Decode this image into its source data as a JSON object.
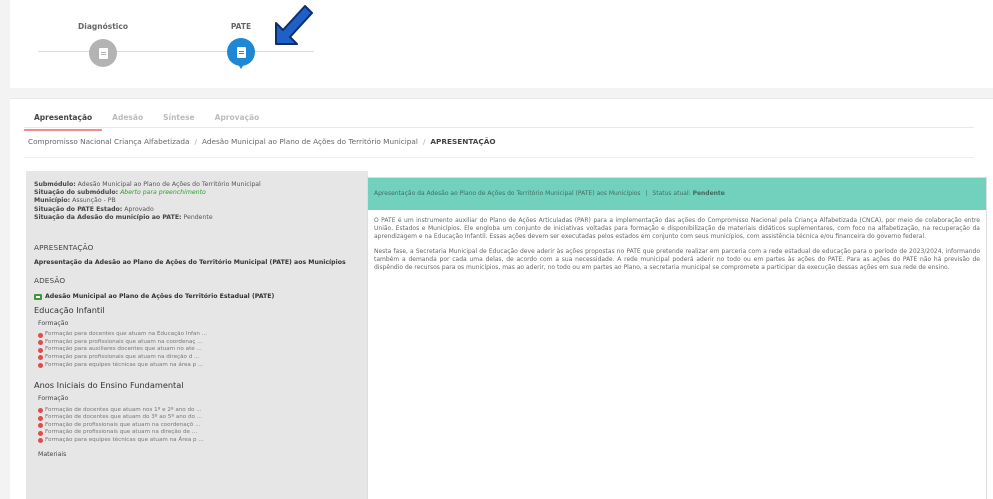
{
  "stepper": {
    "step1_label": "Diagnóstico",
    "step2_label": "PATE",
    "step1_icon": "document-icon",
    "step2_icon": "document-icon",
    "active_color": "#1e88d6",
    "inactive_color": "#b3b3b3"
  },
  "tabs": [
    {
      "label": "Apresentação"
    },
    {
      "label": "Adesão"
    },
    {
      "label": "Síntese"
    },
    {
      "label": "Aprovação"
    }
  ],
  "breadcrumb": {
    "item1": "Compromisso Nacional Criança Alfabetizada",
    "item2": "Adesão Municipal ao Plano de Ações do Território Municipal",
    "current": "APRESENTAÇÃO"
  },
  "sidebar": {
    "submodulo_label": "Submódulo:",
    "submodulo_value": "Adesão Municipal ao Plano de Ações do Território Municipal",
    "situacao_sub_label": "Situação do submódulo:",
    "situacao_sub_value": "Aberto para preenchimento",
    "municipio_label": "Município:",
    "municipio_value": "Assunção - PB",
    "situacao_pate_label": "Situação do PATE Estado:",
    "situacao_pate_value": "Aprovado",
    "situacao_adesao_label": "Situação da Adesão do município ao PATE:",
    "situacao_adesao_value": "Pendente",
    "apresentacao_title": "APRESENTAÇÃO",
    "apresentacao_item": "Apresentação da Adesão ao Plano de Ações do Território Municipal (PATE) aos Municípios",
    "adesao_title": "ADESÃO",
    "adesao_item": "Adesão Municipal ao Plano de Ações do Território Estadual (PATE)",
    "educacao_infantil": "Educação Infantil",
    "formacao1": "Formação",
    "ei_items": [
      "Formação para docentes que atuam na Educação Infan ...",
      "Formação para profissionais que atuam na coordenaç ...",
      "Formação para auxiliares docentes que atuam no ate ...",
      "Formação para profissionais que atuam na direção d ...",
      "Formação para equipes técnicas que atuam na área p ..."
    ],
    "anos_iniciais": "Anos Iniciais do Ensino Fundamental",
    "formacao2": "Formação",
    "ai_items": [
      "Formação de docentes que atuam nos 1º e 2º ano do ...",
      "Formação de docentes que atuam do 3º ao 5º ano do ...",
      "Formação de profissionais que atuam na coordenaçõ ...",
      "Formação de profissionais que atuam na direção de ...",
      "Formação para equipes técnicas que atuam na Área p ..."
    ],
    "materiais": "Materiais"
  },
  "content": {
    "header_title": "Apresentação da Adesão ao Plano de Ações do Território Municipal (PATE) aos Municípios",
    "header_sep": "|",
    "header_status_label": "Status atual:",
    "header_status_value": "Pendente",
    "paragraph1": "O PATE é um instrumento auxiliar do Plano de Ações Articuladas (PAR) para a implementação das ações do Compromisso Nacional pela Criança Alfabetizada (CNCA), por meio de colaboração entre União, Estados e Municípios. Ele engloba um conjunto de iniciativas voltadas para formação e disponibilização de materiais didáticos suplementares, com foco na alfabetização, na recuperação da aprendizagem e na Educação Infantil. Essas ações devem ser executadas pelos estados em conjunto com seus municípios, com assistência técnica e/ou financeira do governo federal.",
    "paragraph2": "Nesta fase, a Secretaria Municipal de Educação deve aderir às ações propostas no PATE que pretende realizar em parceria com a rede estadual de educação para o período de 2023/2024, informando também a demanda por cada uma delas, de acordo com a sua necessidade. A rede municipal poderá aderir no todo ou em partes às ações do PATE. Para as ações do PATE não há previsão de dispêndio de recursos para os municípios, mas ao aderir, no todo ou em partes ao Plano, a secretaria municipal se compromete a participar da execução dessas ações em sua rede de ensino.",
    "header_color": "#72d1bd"
  },
  "annotation": {
    "arrow_icon": "arrow-pointer-icon",
    "arrow_color": "#1e5fc8"
  }
}
